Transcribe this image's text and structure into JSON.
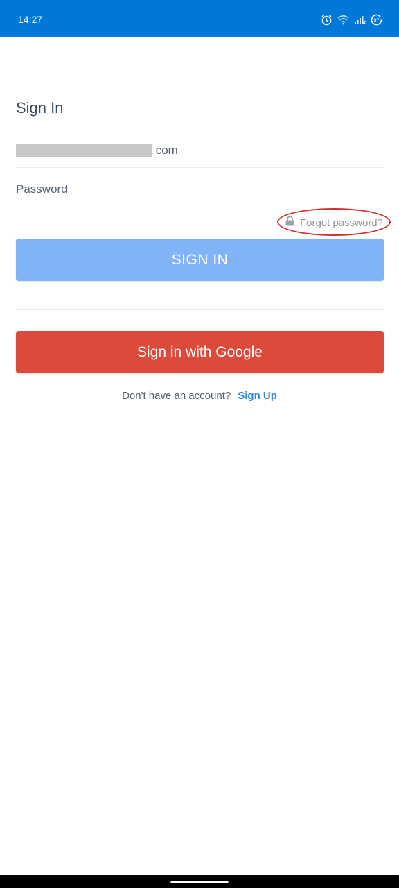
{
  "status_bar": {
    "time": "14:27",
    "icons": [
      "alarm-icon",
      "wifi-icon",
      "cellular-signal-icon",
      "battery-icon"
    ],
    "battery_level": "97",
    "background_color": "#0078d7"
  },
  "page": {
    "title": "Sign In"
  },
  "form": {
    "email_value_suffix": ".com",
    "email_value_redacted": true,
    "password_placeholder": "Password",
    "forgot_password_label": "Forgot password?",
    "forgot_password_icon": "lock-icon",
    "sign_in_button_label": "SIGN IN",
    "google_button_label": "Sign in with Google"
  },
  "signup": {
    "prompt": "Don't have an account?",
    "link_label": "Sign Up"
  },
  "colors": {
    "sign_in_button": "#80b3f8",
    "google_button": "#dc4a3b",
    "link": "#2f88d9",
    "highlight_ring": "#d32f2f"
  }
}
